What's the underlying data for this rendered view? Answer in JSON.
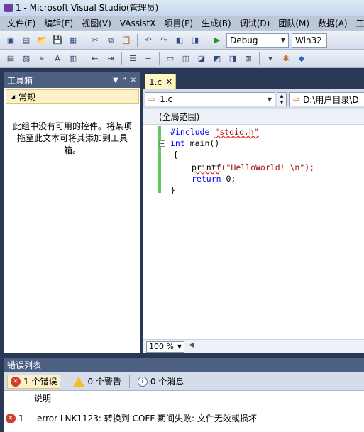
{
  "window": {
    "title": "1 - Microsoft Visual Studio(管理员)"
  },
  "menu": [
    "文件(F)",
    "编辑(E)",
    "视图(V)",
    "VAssistX",
    "项目(P)",
    "生成(B)",
    "调试(D)",
    "团队(M)",
    "数据(A)",
    "工"
  ],
  "toolbar": {
    "config": "Debug",
    "platform": "Win32"
  },
  "toolbox": {
    "title": "工具箱",
    "group": "常规",
    "empty_message": "此组中没有可用的控件。将某项拖至此文本可将其添加到工具箱。"
  },
  "editor": {
    "tab_label": "1.c",
    "nav_file": "1.c",
    "nav_path": "D:\\用户目录\\D",
    "scope": "(全局范围)",
    "zoom": "100 %",
    "code": {
      "line1_pre": "#include",
      "line1_str": "\"stdio.h\"",
      "line2_kw": "int",
      "line2_rest": " main()",
      "line3": "{",
      "line4_fn": "printf",
      "line4_str": "(\"HelloWorld! \\n\");",
      "line5_kw": "return",
      "line5_rest": " 0;",
      "line6": "}"
    }
  },
  "error_list": {
    "title": "错误列表",
    "errors_filter": "1 个错误",
    "warnings_filter": "0 个警告",
    "messages_filter": "0 个消息",
    "col_description": "说明",
    "rows": [
      {
        "num": "1",
        "description": "error LNK1123: 转换到 COFF 期间失败: 文件无效或损坏"
      }
    ]
  }
}
